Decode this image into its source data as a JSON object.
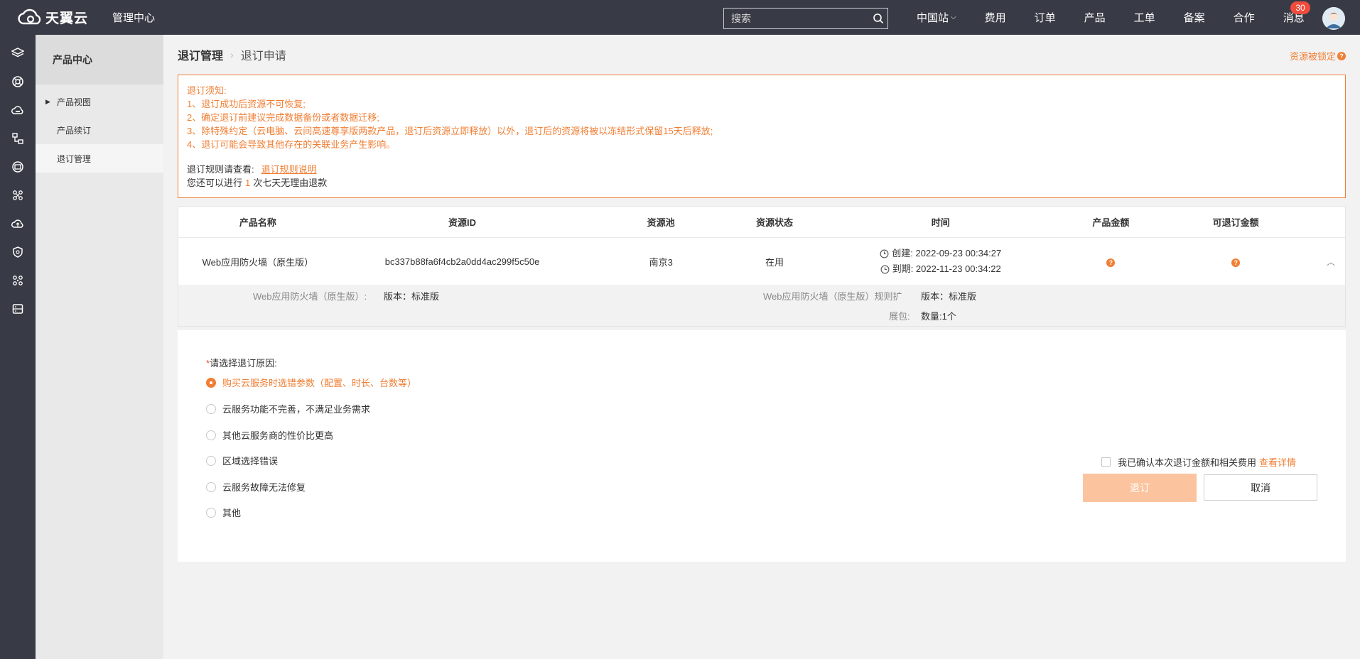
{
  "header": {
    "brand": "天翼云",
    "mgmt_center": "管理中心",
    "search_placeholder": "搜索",
    "nav": [
      "中国站",
      "费用",
      "订单",
      "产品",
      "工单",
      "备案",
      "合作",
      "消息"
    ],
    "message_count": "30"
  },
  "sidebar": {
    "title": "产品中心",
    "items": [
      {
        "label": "产品视图"
      },
      {
        "label": "产品续订"
      },
      {
        "label": "退订管理"
      }
    ]
  },
  "breadcrumb": {
    "parent": "退订管理",
    "current": "退订申请"
  },
  "resource_locked": "资源被锁定",
  "notice": {
    "heading": "退订须知:",
    "lines": [
      "1、退订成功后资源不可恢复;",
      "2、确定退订前建议完成数据备份或者数据迁移;",
      "3、除特殊约定（云电脑、云间高速尊享版两款产品，退订后资源立即释放）以外，退订后的资源将被以冻结形式保留15天后释放;",
      "4、退订可能会导致其他存在的关联业务产生影响。"
    ],
    "rule_prefix": "退订规则请查看:",
    "rule_link": "退订规则说明",
    "count_prefix": "您还可以进行",
    "count_value": "1",
    "count_suffix": "次七天无理由退款"
  },
  "table": {
    "headers": [
      "产品名称",
      "资源ID",
      "资源池",
      "资源状态",
      "时间",
      "产品金额",
      "可退订金额"
    ],
    "row": {
      "product": "Web应用防火墙（原生版）",
      "resource_id": "bc337b88fa6f4cb2a0dd4ac299f5c50e",
      "pool": "南京3",
      "status": "在用",
      "created": "创建: 2022-09-23 00:34:27",
      "expires": "到期: 2022-11-23 00:34:22"
    },
    "detail": {
      "left_label": "Web应用防火墙（原生版）:",
      "left_value": "版本：标准版",
      "right_label_1": "Web应用防火墙（原生版）规则扩",
      "right_label_2": "展包:",
      "right_value_1": "版本：标准版",
      "right_value_2": "数量:1个"
    }
  },
  "reason": {
    "required_mark": "*",
    "title": "请选择退订原因:",
    "options": [
      "购买云服务时选错参数（配置、时长、台数等）",
      "云服务功能不完善，不满足业务需求",
      "其他云服务商的性价比更高",
      "区域选择错误",
      "云服务故障无法修复",
      "其他"
    ],
    "selected_index": 0
  },
  "confirm": {
    "label": "我已确认本次退订金额和相关费用",
    "link": "查看详情"
  },
  "buttons": {
    "unsubscribe": "退订",
    "cancel": "取消"
  },
  "colors": {
    "accent": "#f07e33",
    "topbar": "#383b45",
    "badge": "#f04b3d"
  }
}
